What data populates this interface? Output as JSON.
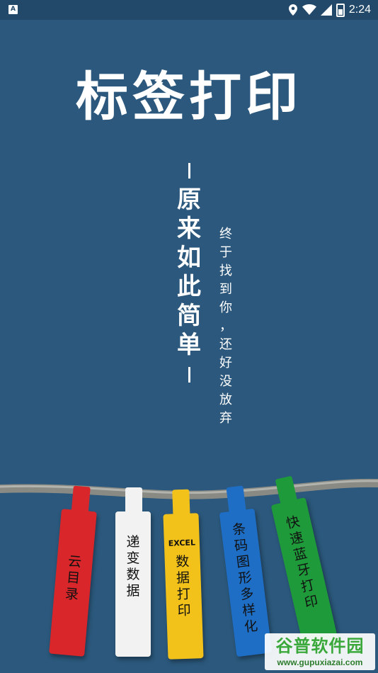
{
  "status_bar": {
    "app_icon_letter": "A",
    "time": "2:24",
    "icons": [
      "location-icon",
      "wifi-icon",
      "signal-icon",
      "battery-icon"
    ]
  },
  "splash": {
    "title": "标签打印",
    "tagline_main": [
      "原",
      "来",
      "如",
      "此",
      "简",
      "单"
    ],
    "tagline_sub": [
      "终",
      "于",
      "找",
      "到",
      "你",
      "，",
      "还",
      "好",
      "没",
      "放",
      "弃"
    ]
  },
  "tags": [
    {
      "lines": [
        "云",
        "目",
        "录"
      ],
      "color": "#d9262a"
    },
    {
      "lines": [
        "递",
        "变",
        "数",
        "据"
      ],
      "color": "#f2f2f2"
    },
    {
      "prefix": "EXCEL",
      "lines": [
        "数",
        "据",
        "打",
        "印"
      ],
      "color": "#f3c21a"
    },
    {
      "lines": [
        "条",
        "码",
        "图",
        "形",
        "多",
        "样",
        "化"
      ],
      "color": "#1e6ec6"
    },
    {
      "lines": [
        "快",
        "速",
        "蓝",
        "牙",
        "打",
        "印"
      ],
      "color": "#1f9a3a"
    }
  ],
  "watermark": {
    "brand": "谷普软件园",
    "url": "www.gupuxiazai.com"
  },
  "colors": {
    "background": "#2b587c",
    "status_bar": "#23496a"
  }
}
